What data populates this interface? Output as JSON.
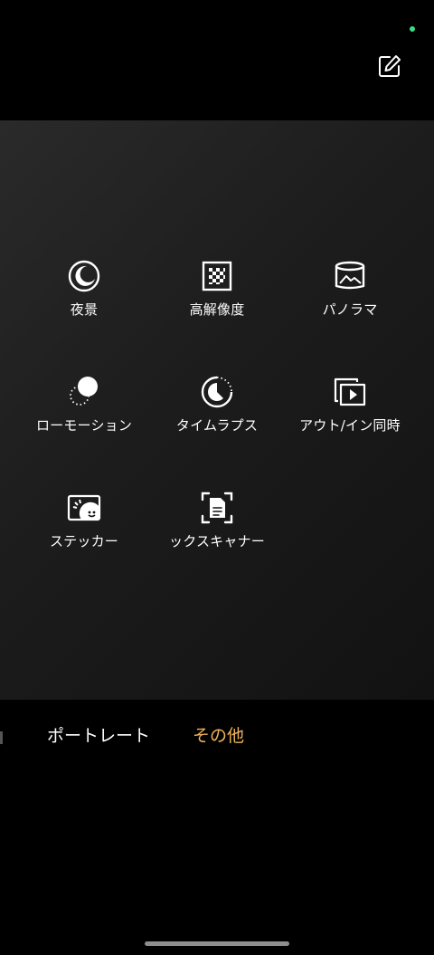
{
  "modes": [
    {
      "label": "夜景",
      "icon": "night-icon"
    },
    {
      "label": "高解像度",
      "icon": "high-resolution-icon"
    },
    {
      "label": "パノラマ",
      "icon": "panorama-icon"
    },
    {
      "label": "ローモーション",
      "icon": "slow-motion-icon"
    },
    {
      "label": "タイムラプス",
      "icon": "timelapse-icon"
    },
    {
      "label": "アウト/イン同時",
      "icon": "dual-view-icon"
    },
    {
      "label": "ステッカー",
      "icon": "sticker-icon"
    },
    {
      "label": "ックスキャナー",
      "icon": "document-scanner-icon"
    }
  ],
  "tabs": {
    "portrait": "ポートレート",
    "other": "その他"
  },
  "colors": {
    "active_tab": "#f2b45a",
    "status_dot": "#3ddc84"
  }
}
